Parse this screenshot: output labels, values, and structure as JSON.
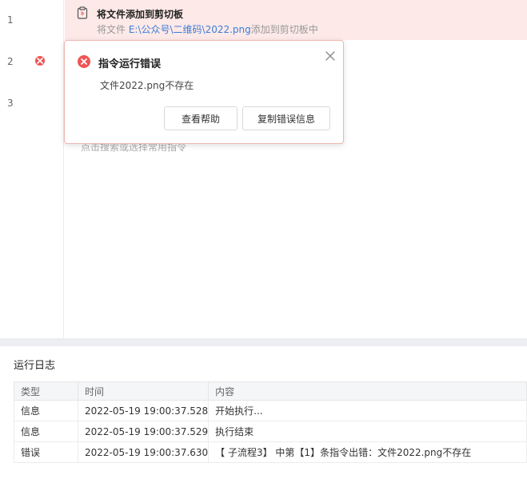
{
  "gutter": {
    "lines": [
      "1",
      "2",
      "3"
    ]
  },
  "step": {
    "title": "将文件添加到剪切板",
    "desc_prefix": "将文件 ",
    "desc_path": "E:\\公众号\\二维码\\2022.png",
    "desc_suffix": "添加到剪切板中"
  },
  "add_hint": "点击搜索或选择常用指令",
  "popup": {
    "title": "指令运行错误",
    "message": "文件2022.png不存在",
    "help_label": "查看帮助",
    "copy_label": "复制错误信息"
  },
  "log": {
    "title": "运行日志",
    "columns": [
      "类型",
      "时间",
      "内容"
    ],
    "rows": [
      {
        "type": "信息",
        "time": "2022-05-19 19:00:37.528",
        "content": "开始执行..."
      },
      {
        "type": "信息",
        "time": "2022-05-19 19:00:37.529",
        "content": "执行结束"
      },
      {
        "type": "错误",
        "time": "2022-05-19 19:00:37.630",
        "content": "【 子流程3】 中第【1】条指令出错：文件2022.png不存在"
      }
    ]
  },
  "colors": {
    "error": "#f05454",
    "error_bg": "#fde9e8",
    "path_link": "#3b7dd8"
  }
}
